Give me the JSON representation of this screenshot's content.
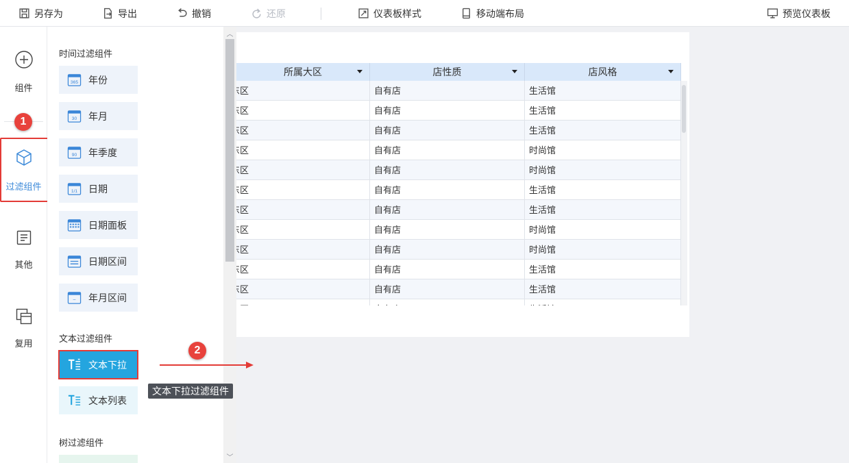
{
  "toolbar": {
    "save_as": "另存为",
    "export": "导出",
    "undo": "撤销",
    "redo": "还原",
    "dashboard_style": "仪表板样式",
    "mobile_layout": "移动端布局",
    "preview": "预览仪表板"
  },
  "leftnav": {
    "items": [
      {
        "label": "组件",
        "icon": "plus-circle-icon"
      },
      {
        "label": "过滤组件",
        "icon": "cube-icon"
      },
      {
        "label": "其他",
        "icon": "document-icon"
      },
      {
        "label": "复用",
        "icon": "reuse-icon"
      }
    ]
  },
  "panel": {
    "time_section": "时间过滤组件",
    "time_items": [
      {
        "label": "年份",
        "icon_text": "365"
      },
      {
        "label": "年月",
        "icon_text": "30"
      },
      {
        "label": "年季度",
        "icon_text": "90"
      },
      {
        "label": "日期",
        "icon_text": "1/1"
      },
      {
        "label": "日期面板",
        "icon_text": ""
      },
      {
        "label": "日期区间",
        "icon_text": ""
      },
      {
        "label": "年月区间",
        "icon_text": "~"
      }
    ],
    "text_section": "文本过滤组件",
    "text_items": [
      {
        "label": "文本下拉"
      },
      {
        "label": "文本列表"
      }
    ],
    "tree_section": "树过滤组件"
  },
  "table": {
    "headers": [
      "所属大区",
      "店性质",
      "店风格"
    ],
    "rows": [
      [
        "东区",
        "自有店",
        "生活馆"
      ],
      [
        "东区",
        "自有店",
        "生活馆"
      ],
      [
        "东区",
        "自有店",
        "生活馆"
      ],
      [
        "东区",
        "自有店",
        "时尚馆"
      ],
      [
        "东区",
        "自有店",
        "时尚馆"
      ],
      [
        "东区",
        "自有店",
        "生活馆"
      ],
      [
        "东区",
        "自有店",
        "生活馆"
      ],
      [
        "东区",
        "自有店",
        "时尚馆"
      ],
      [
        "东区",
        "自有店",
        "时尚馆"
      ],
      [
        "东区",
        "自有店",
        "生活馆"
      ],
      [
        "东区",
        "自有店",
        "生活馆"
      ],
      [
        "东区",
        "自有店",
        "生活馆"
      ]
    ]
  },
  "annotations": {
    "badge1": "1",
    "badge2": "2",
    "tooltip": "文本下拉过滤组件"
  },
  "colors": {
    "accent": "#3d8ad9",
    "selected_bg": "#24a5df",
    "highlight_red": "#e33b36",
    "header_bg": "#d9e8fa"
  }
}
